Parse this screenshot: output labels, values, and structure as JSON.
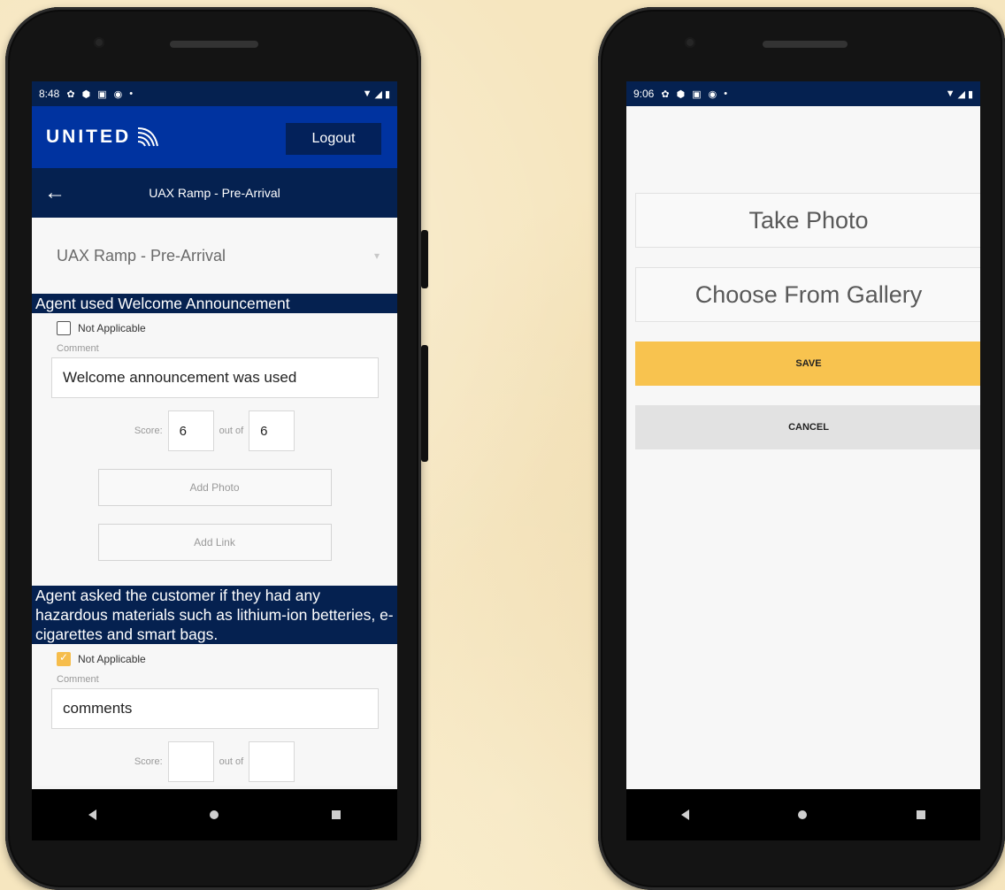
{
  "left_phone": {
    "status": {
      "time": "8:48",
      "icons": [
        "gear-icon",
        "shield-icon",
        "sim-icon",
        "at-icon",
        "dot-icon"
      ]
    },
    "header": {
      "logo_text": "UNITED",
      "logout_label": "Logout"
    },
    "subheader": {
      "title": "UAX Ramp - Pre-Arrival"
    },
    "dropdown": {
      "value": "UAX Ramp - Pre-Arrival"
    },
    "sections": [
      {
        "title": "Agent used Welcome Announcement",
        "not_applicable_label": "Not Applicable",
        "not_applicable_checked": false,
        "comment_label": "Comment",
        "comment_value": "Welcome announcement was used",
        "score_label": "Score:",
        "score_value": "6",
        "out_of_label": "out of",
        "out_of_value": "6",
        "add_photo_label": "Add Photo",
        "add_link_label": "Add Link"
      },
      {
        "title": "Agent asked the customer if they had any hazardous materials such as lithium-ion betteries, e-cigarettes and smart bags.",
        "not_applicable_label": "Not Applicable",
        "not_applicable_checked": true,
        "comment_label": "Comment",
        "comment_value": "comments",
        "score_label": "Score:",
        "score_value": "",
        "out_of_label": "out of",
        "out_of_value": ""
      }
    ]
  },
  "right_phone": {
    "status": {
      "time": "9:06"
    },
    "take_photo_label": "Take Photo",
    "gallery_label": "Choose From Gallery",
    "save_label": "SAVE",
    "cancel_label": "CANCEL"
  },
  "colors": {
    "brand_blue": "#0033a0",
    "navy": "#052150",
    "accent_yellow": "#f8c34f",
    "cancel_gray": "#e2e2e2"
  }
}
